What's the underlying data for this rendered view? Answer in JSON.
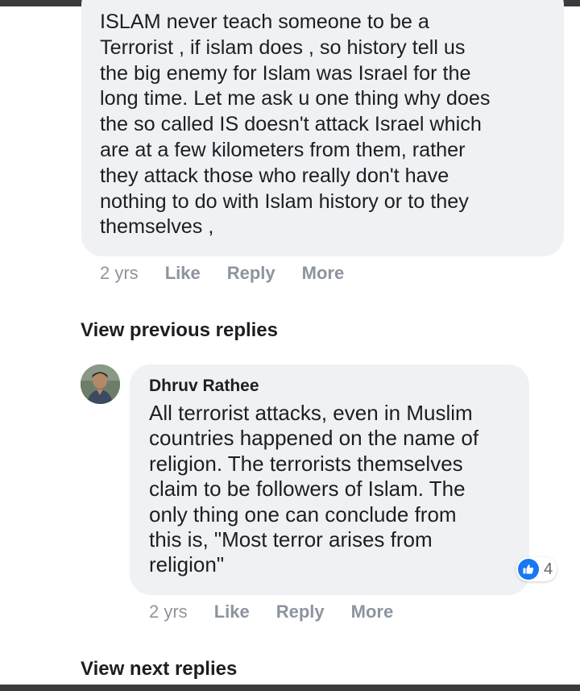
{
  "comment_1": {
    "text": "ISLAM never teach someone to be a\nTerrorist , if islam does , so history tell us\nthe big enemy for Islam was Israel for the\nlong time. Let me ask u one thing why does\nthe so called IS doesn't attack Israel which\nare at a few kilometers from them, rather\nthey attack those who really don't have\nnothing to do with Islam history or to they\nthemselves ,",
    "time": "2 yrs",
    "like_label": "Like",
    "reply_label": "Reply",
    "more_label": "More"
  },
  "view_previous_label": "View previous replies",
  "reply_1": {
    "author": "Dhruv Rathee",
    "text": "All terrorist attacks, even in Muslim\ncountries happened on the name of\nreligion. The terrorists themselves\nclaim to be followers of Islam. The\nonly thing one can conclude from\nthis is, \"Most terror arises from\nreligion\"",
    "reaction_icon": "like-thumb-icon",
    "reaction_count": "4",
    "time": "2 yrs",
    "like_label": "Like",
    "reply_label": "Reply",
    "more_label": "More"
  },
  "view_next_label": "View next replies",
  "colors": {
    "bubble_bg": "#eff1f5",
    "meta_text": "#8d949e",
    "reaction_blue": "#1877f2",
    "frame_dark": "#3a3b3c"
  }
}
